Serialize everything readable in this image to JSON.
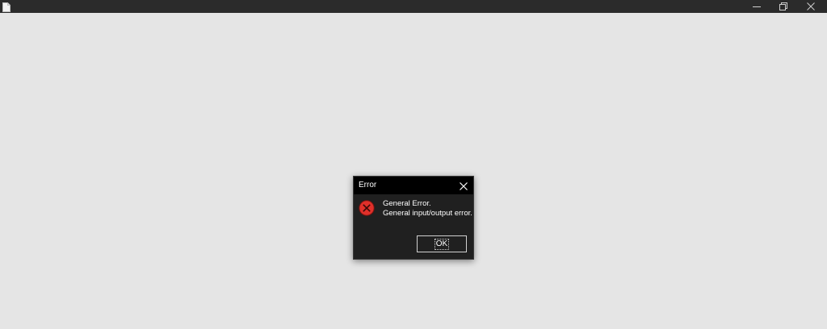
{
  "window": {
    "title_icon": "document-icon",
    "controls": [
      "minimize-icon",
      "restore-icon",
      "close-icon"
    ]
  },
  "dialog": {
    "title": "Error",
    "icon": "error-icon",
    "message_line1": "General Error.",
    "message_line2": "General input/output error.",
    "ok_label": "OK"
  },
  "colors": {
    "background": "#e5e5e5",
    "titlebar": "#2b2b2b",
    "dialog_body": "#202020",
    "dialog_title": "#000000",
    "error_red": "#e0302a"
  }
}
